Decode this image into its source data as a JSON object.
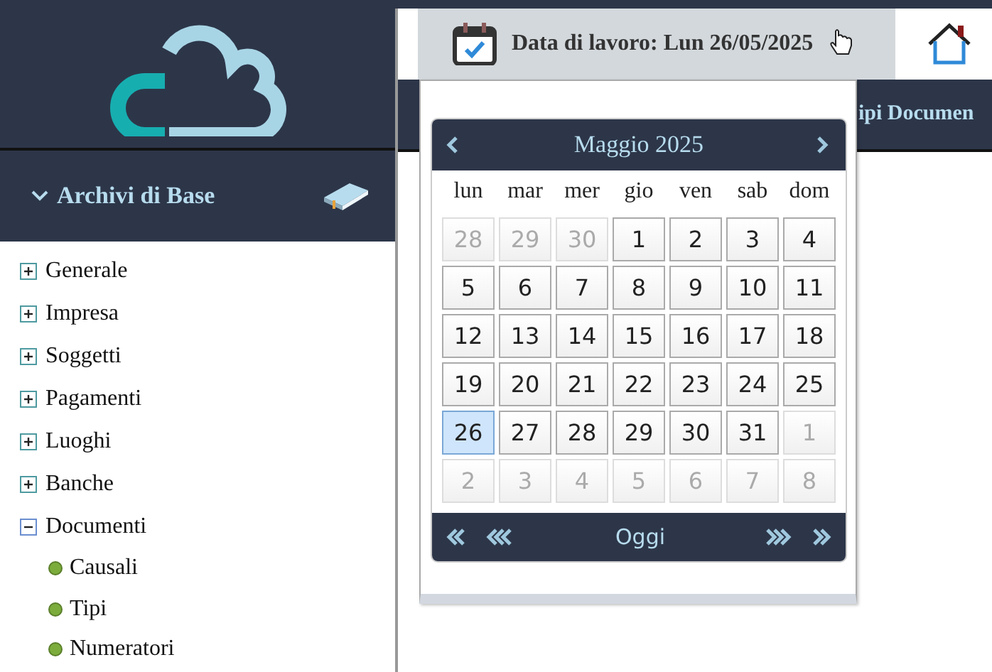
{
  "sidebar": {
    "section": {
      "title": "Archivi di Base",
      "expanded": true
    },
    "tree": [
      {
        "label": "Generale",
        "expanded": false
      },
      {
        "label": "Impresa",
        "expanded": false
      },
      {
        "label": "Soggetti",
        "expanded": false
      },
      {
        "label": "Pagamenti",
        "expanded": false
      },
      {
        "label": "Luoghi",
        "expanded": false
      },
      {
        "label": "Banche",
        "expanded": false
      },
      {
        "label": "Documenti",
        "expanded": true,
        "children": [
          {
            "label": "Causali"
          },
          {
            "label": "Tipi"
          },
          {
            "label": "Numeratori"
          }
        ]
      }
    ]
  },
  "topbar": {
    "work_date": "Data di lavoro: Lun 26/05/2025"
  },
  "navbar": {
    "tab_text": "ipi Documen"
  },
  "calendar": {
    "month": "Maggio 2025",
    "weekdays": [
      "lun",
      "mar",
      "mer",
      "gio",
      "ven",
      "sab",
      "dom"
    ],
    "weeks": [
      [
        {
          "label": "28",
          "muted": true,
          "selected": false
        },
        {
          "label": "29",
          "muted": true,
          "selected": false
        },
        {
          "label": "30",
          "muted": true,
          "selected": false
        },
        {
          "label": "1",
          "muted": false,
          "selected": false
        },
        {
          "label": "2",
          "muted": false,
          "selected": false
        },
        {
          "label": "3",
          "muted": false,
          "selected": false
        },
        {
          "label": "4",
          "muted": false,
          "selected": false
        }
      ],
      [
        {
          "label": "5",
          "muted": false,
          "selected": false
        },
        {
          "label": "6",
          "muted": false,
          "selected": false
        },
        {
          "label": "7",
          "muted": false,
          "selected": false
        },
        {
          "label": "8",
          "muted": false,
          "selected": false
        },
        {
          "label": "9",
          "muted": false,
          "selected": false
        },
        {
          "label": "10",
          "muted": false,
          "selected": false
        },
        {
          "label": "11",
          "muted": false,
          "selected": false
        }
      ],
      [
        {
          "label": "12",
          "muted": false,
          "selected": false
        },
        {
          "label": "13",
          "muted": false,
          "selected": false
        },
        {
          "label": "14",
          "muted": false,
          "selected": false
        },
        {
          "label": "15",
          "muted": false,
          "selected": false
        },
        {
          "label": "16",
          "muted": false,
          "selected": false
        },
        {
          "label": "17",
          "muted": false,
          "selected": false
        },
        {
          "label": "18",
          "muted": false,
          "selected": false
        }
      ],
      [
        {
          "label": "19",
          "muted": false,
          "selected": false
        },
        {
          "label": "20",
          "muted": false,
          "selected": false
        },
        {
          "label": "21",
          "muted": false,
          "selected": false
        },
        {
          "label": "22",
          "muted": false,
          "selected": false
        },
        {
          "label": "23",
          "muted": false,
          "selected": false
        },
        {
          "label": "24",
          "muted": false,
          "selected": false
        },
        {
          "label": "25",
          "muted": false,
          "selected": false
        }
      ],
      [
        {
          "label": "26",
          "muted": false,
          "selected": true
        },
        {
          "label": "27",
          "muted": false,
          "selected": false
        },
        {
          "label": "28",
          "muted": false,
          "selected": false
        },
        {
          "label": "29",
          "muted": false,
          "selected": false
        },
        {
          "label": "30",
          "muted": false,
          "selected": false
        },
        {
          "label": "31",
          "muted": false,
          "selected": false
        },
        {
          "label": "1",
          "muted": true,
          "selected": false
        }
      ],
      [
        {
          "label": "2",
          "muted": true,
          "selected": false
        },
        {
          "label": "3",
          "muted": true,
          "selected": false
        },
        {
          "label": "4",
          "muted": true,
          "selected": false
        },
        {
          "label": "5",
          "muted": true,
          "selected": false
        },
        {
          "label": "6",
          "muted": true,
          "selected": false
        },
        {
          "label": "7",
          "muted": true,
          "selected": false
        },
        {
          "label": "8",
          "muted": true,
          "selected": false
        }
      ]
    ],
    "today_button": "Oggi"
  }
}
